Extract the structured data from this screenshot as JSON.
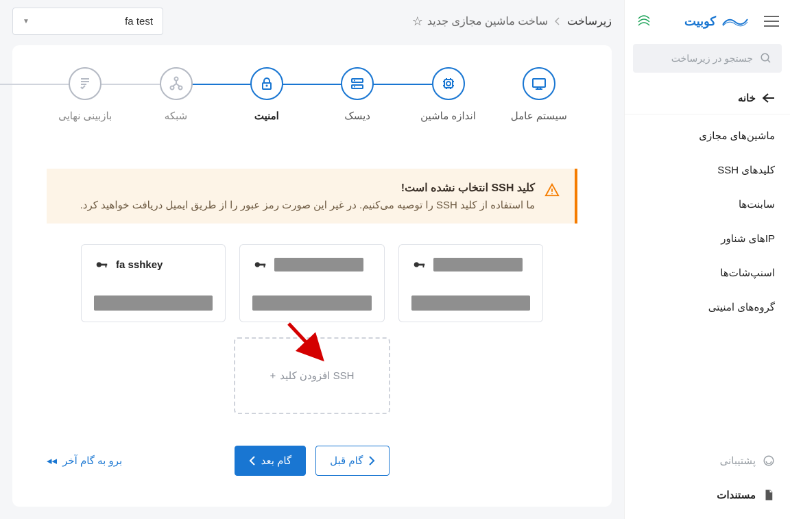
{
  "brand": {
    "name": "کوبیت"
  },
  "search": {
    "placeholder": "جستجو در زیرساخت"
  },
  "nav": {
    "home": "خانه",
    "items": [
      "ماشین‌های مجازی",
      "کلیدهای SSH",
      "سابنت‌ها",
      "IPهای شناور",
      "اسنپ‌شات‌ها",
      "گروه‌های امنیتی"
    ],
    "support": "پشتیبانی",
    "docs": "مستندات"
  },
  "breadcrumb": {
    "root": "زیرساخت",
    "current": "ساخت ماشین مجازی جدید"
  },
  "project": {
    "selected": "fa test"
  },
  "steps": [
    "سیستم عامل",
    "اندازه ماشین",
    "دیسک",
    "امنیت",
    "شبکه",
    "بازبینی نهایی"
  ],
  "warning": {
    "title": "کلید SSH انتخاب نشده است!",
    "text": "ما استفاده از کلید SSH را توصیه می‌کنیم. در غیر این صورت رمز عبور را از طریق ایمیل دریافت خواهید کرد."
  },
  "ssh": {
    "cards": [
      {
        "name": "fa sshkey"
      },
      {
        "name": ""
      },
      {
        "name": ""
      }
    ],
    "add_label": "افزودن کلید SSH"
  },
  "footer": {
    "prev": "گام قبل",
    "next": "گام بعد",
    "skip": "برو به گام آخر"
  }
}
